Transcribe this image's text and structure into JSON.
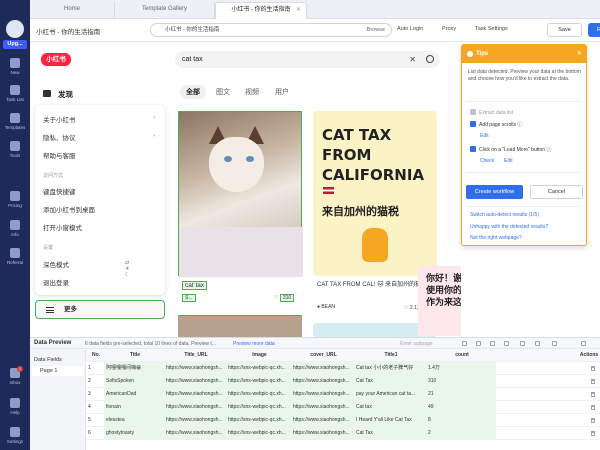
{
  "sidebar": {
    "upgrade_label": "Upg...",
    "items": [
      {
        "label": "New",
        "icon": "plus-icon"
      },
      {
        "label": "Task List",
        "icon": "list-icon"
      },
      {
        "label": "Templates",
        "icon": "template-icon"
      },
      {
        "label": "Tools",
        "icon": "toolbox-icon"
      },
      {
        "label": "Pricing",
        "icon": "price-icon"
      },
      {
        "label": "Info",
        "icon": "info-icon"
      },
      {
        "label": "Referral",
        "icon": "gift-icon"
      }
    ],
    "bottom": [
      {
        "label": "Inbox",
        "icon": "inbox-icon",
        "badge": "1"
      },
      {
        "label": "Help",
        "icon": "help-icon"
      },
      {
        "label": "Settings",
        "icon": "gear-icon"
      }
    ]
  },
  "tabs": [
    {
      "label": "Home"
    },
    {
      "label": "Template Gallery"
    },
    {
      "label": "小红书 - 你的生活指南",
      "active": true
    }
  ],
  "toolbar": {
    "page_title": "小红书 - 你的生活指南",
    "url": "小红书 - 你的生活指南",
    "browse": "Browse",
    "auto_login": "Auto Login",
    "proxy": "Proxy",
    "task_settings": "Task Settings",
    "save": "Save",
    "run": "Run"
  },
  "web": {
    "logo": "小红书",
    "search_value": "cat tax",
    "home_label": "发现",
    "menu": {
      "items": [
        "关于小红书",
        "隐私、协议",
        "帮助与客服"
      ],
      "section_access": "访问方式",
      "access_items": [
        "键盘快捷键",
        "添加小红书到桌面",
        "打开小窗模式"
      ],
      "section_settings": "设置",
      "settings_items": [
        "深色模式",
        "退出登录"
      ]
    },
    "more_label": "更多",
    "filter_tabs": [
      "全部",
      "图文",
      "视频",
      "用户"
    ],
    "cards": [
      {
        "title": "cat tax",
        "user": "S...",
        "likes": "310"
      },
      {
        "title_en": "CAT TAX FROM CALIFORNIA",
        "title_zh": "来自加州的猫税",
        "caption": "CAT TAX FROM CAL! 🐱 来自加州的猫税",
        "user": "BEAN",
        "likes": "2.1万"
      },
      {
        "text_zh": "你好！谢谢我们的中国朋友欢迎我们美国人使用你的应用程序！😺这是我的猫的照片，作为来这里的税"
      }
    ]
  },
  "tips": {
    "header": "Tips",
    "description": "List data detected. Preview your data at the bottom and choose how you'd like to extract the data.",
    "opt_extract": "Extract data list",
    "opt_scroll": "Add page scrolls",
    "edit1": "Edit",
    "opt_loadmore": "Click on a \"Load More\" button",
    "check": "Check",
    "edit2": "Edit",
    "create_workflow": "Create workflow",
    "cancel": "Cancel",
    "switch": "Switch auto-detect results (1/5)",
    "unhappy": "Unhappy with the detected results?",
    "not_right": "Not the right webpage?"
  },
  "data_preview": {
    "title": "Data Preview",
    "info": "6 data fields pre-selected, total 10 lines of data. Preview t...",
    "preview_link": "Preview more data",
    "enter_subpage": "Enter subpage",
    "fields_label": "Data Fields",
    "page_label": "Page 1",
    "columns": [
      "No.",
      "Title",
      "Title_URL",
      "Image",
      "cover_URL",
      "Title1",
      "count",
      "Actions"
    ],
    "rows": [
      [
        "1",
        "阿嚏嘎嘎间嗨😁",
        "https://www.xiaohongsh...",
        "https://sns-webpic-qc.xh...",
        "https://www.xiaohongsh...",
        "Cat tax 小小的老子脾气好",
        "1.4万"
      ],
      [
        "2",
        "SofisSpoken",
        "https://www.xiaohongsh...",
        "https://sns-webpic-qc.xh...",
        "https://www.xiaohongsh...",
        "Cat Tax",
        "310"
      ],
      [
        "3",
        "AmericanDad",
        "https://www.xiaohongsh...",
        "https://sns-webpic-qc.xh...",
        "https://www.xiaohongsh...",
        "pay your American cat ta...",
        "21"
      ],
      [
        "4",
        "fionain",
        "https://www.xiaohongsh...",
        "https://sns-webpic-qc.xh...",
        "https://www.xiaohongsh...",
        "Cat tax",
        "49"
      ],
      [
        "5",
        "elesstea",
        "https://www.xiaohongsh...",
        "https://sns-webpic-qc.xh...",
        "https://www.xiaohongsh...",
        "I Heard Y'all Like Cat Tax",
        "8"
      ],
      [
        "6",
        "ghostytoasty",
        "https://www.xiaohongsh...",
        "https://sns-webpic-qc.xh...",
        "https://www.xiaohongsh...",
        "Cat Tax",
        "2"
      ]
    ]
  },
  "colors": {
    "accent": "#2f6fed",
    "sidebar": "#1e2a5a",
    "brand_red": "#ff2442",
    "tips_orange": "#f5a623",
    "select_green": "#4caf50"
  }
}
